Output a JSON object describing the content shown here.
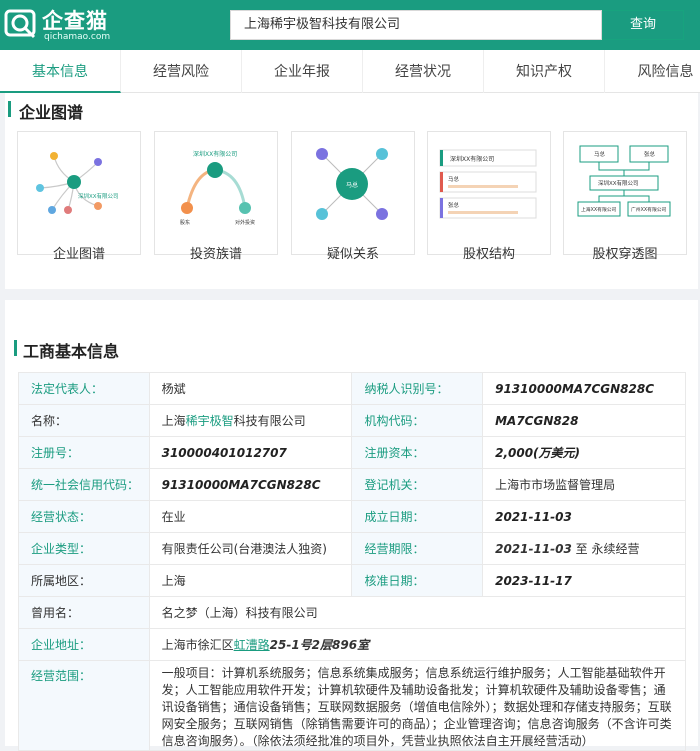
{
  "brand": {
    "name": "企查猫",
    "sub": "qichamao.com"
  },
  "search": {
    "value": "上海稀宇极智科技有限公司",
    "button": "查询"
  },
  "tabs": [
    "基本信息",
    "经营风险",
    "企业年报",
    "经营状况",
    "知识产权",
    "风险信息"
  ],
  "graph": {
    "title": "企业图谱",
    "items": [
      {
        "label": "企业图谱",
        "nodes": [
          "深圳XX有限公司",
          "深圳XX有限公司"
        ]
      },
      {
        "label": "投资族谱",
        "nodes": [
          "深圳XX有限公司",
          "股东",
          "对外投资"
        ]
      },
      {
        "label": "疑似关系",
        "nodes": [
          "马总"
        ]
      },
      {
        "label": "股权结构",
        "nodes": [
          "深圳XX有限公司",
          "马总",
          "张总"
        ]
      },
      {
        "label": "股权穿透图",
        "nodes": [
          "马总",
          "张总",
          "深圳XX有限公司",
          "上海XX有限公司",
          "广州XX有限公司"
        ]
      }
    ]
  },
  "basic": {
    "title": "工商基本信息",
    "legal_rep_k": "法定代表人：",
    "legal_rep_v": "杨斌",
    "taxid_k": "纳税人识别号：",
    "taxid_v": "91310000MA7CGN828C",
    "name_k": "名称：",
    "name_v1": "上海",
    "name_v2": "稀宇极智",
    "name_v3": "科技有限公司",
    "orgcode_k": "机构代码：",
    "orgcode_v": "MA7CGN828",
    "regno_k": "注册号：",
    "regno_v": "310000401012707",
    "capital_k": "注册资本：",
    "capital_v": "2,000(万美元)",
    "credit_k": "统一社会信用代码：",
    "credit_v": "91310000MA7CGN828C",
    "authority_k": "登记机关：",
    "authority_v": "上海市市场监督管理局",
    "status_k": "经营状态：",
    "status_v": "在业",
    "founded_k": "成立日期：",
    "founded_v": "2021-11-03",
    "type_k": "企业类型：",
    "type_v": "有限责任公司(台港澳法人独资)",
    "term_k": "经营期限：",
    "term_v1": "2021-11-03",
    "term_v2": " 至 永续经营",
    "region_k": "所属地区：",
    "region_v": "上海",
    "approve_k": "核准日期：",
    "approve_v": "2023-11-17",
    "former_k": "曾用名：",
    "former_v": "名之梦（上海）科技有限公司",
    "address_k": "企业地址：",
    "address_v1": "上海市徐汇区",
    "address_v2": "虹漕路",
    "address_v3": "25-1号2层896室",
    "scope_k": "经营范围：",
    "scope_v": "一般项目：计算机系统服务；信息系统集成服务；信息系统运行维护服务；人工智能基础软件开发；人工智能应用软件开发；计算机软硬件及辅助设备批发；计算机软硬件及辅助设备零售；通讯设备销售；通信设备销售；互联网数据服务（增值电信除外）；数据处理和存储支持服务；互联网安全服务；互联网销售（除销售需要许可的商品）；企业管理咨询；信息咨询服务（不含许可类信息咨询服务）。（除依法须经批准的项目外，凭营业执照依法自主开展经营活动）"
  }
}
